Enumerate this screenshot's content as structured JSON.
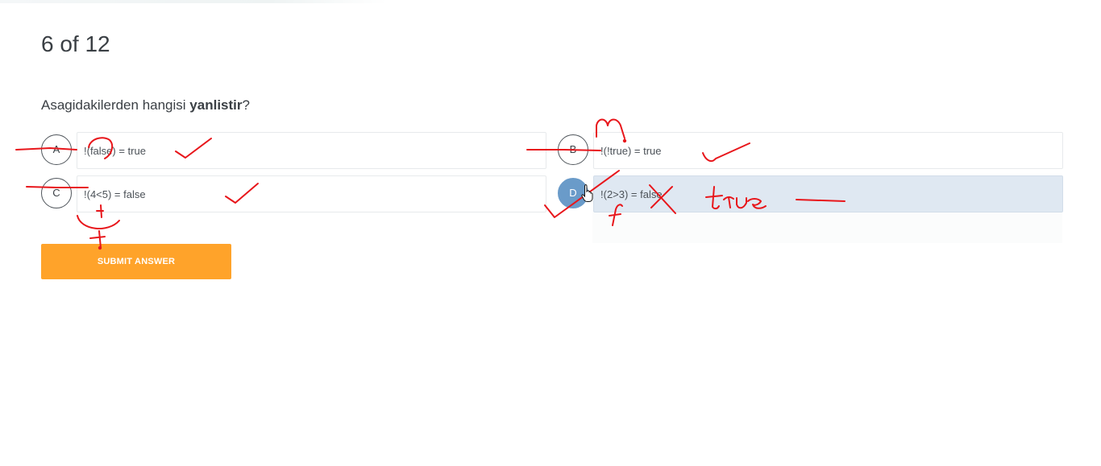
{
  "quiz": {
    "counter": "6 of 12",
    "question": {
      "prefix": "Asagidakilerden hangisi ",
      "emphasis": "yanlistir",
      "suffix": "?"
    },
    "options": [
      {
        "letter": "A",
        "text": "!(false) = true",
        "selected": false
      },
      {
        "letter": "B",
        "text": "!(!true) = true",
        "selected": false
      },
      {
        "letter": "C",
        "text": "!(4<5) = false",
        "selected": false
      },
      {
        "letter": "D",
        "text": "!(2>3) = false",
        "selected": true
      }
    ],
    "submit_label": "SUBMIT ANSWER"
  },
  "colors": {
    "accent_orange": "#ffa32a",
    "selected_blue": "#6a9bc9",
    "selected_fill": "#dfe8f2",
    "annotation_red": "#e8161b"
  },
  "annotations": {
    "handwritten_word": "true",
    "handwritten_letters": [
      "m",
      "t",
      "t",
      "f"
    ]
  }
}
